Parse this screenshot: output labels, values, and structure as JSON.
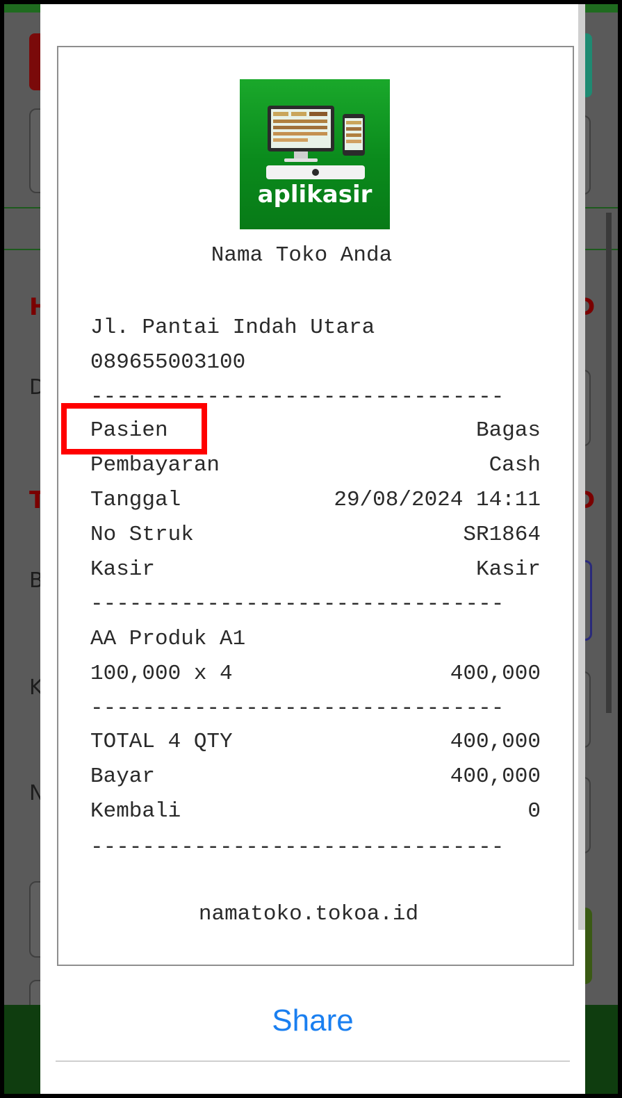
{
  "background": {
    "red_letters": [
      "H",
      "D",
      "T",
      "D"
    ],
    "side_letters": [
      "D",
      "B",
      "K",
      "N"
    ]
  },
  "receipt": {
    "logo_text": "aplikasir",
    "shop_name": "Nama Toko Anda",
    "address": "Jl. Pantai Indah Utara",
    "phone": "089655003100",
    "separator": "--------------------------------",
    "info": [
      {
        "label": "Pasien",
        "value": "Bagas"
      },
      {
        "label": "Pembayaran",
        "value": "Cash"
      },
      {
        "label": "Tanggal",
        "value": "29/08/2024 14:11"
      },
      {
        "label": "No Struk",
        "value": "SR1864"
      },
      {
        "label": "Kasir",
        "value": "Kasir"
      }
    ],
    "item": {
      "name": "AA Produk A1",
      "qty_line": "100,000 x 4",
      "subtotal": "400,000"
    },
    "totals": [
      {
        "label": "TOTAL 4 QTY",
        "value": "400,000"
      },
      {
        "label": "Bayar",
        "value": "400,000"
      },
      {
        "label": "Kembali",
        "value": "0"
      }
    ],
    "footer": "namatoko.tokoa.id"
  },
  "actions": {
    "share_label": "Share"
  },
  "colors": {
    "accent": "#1a7ff0",
    "highlight": "#ff0000",
    "brand_green": "#0a8a1c"
  }
}
